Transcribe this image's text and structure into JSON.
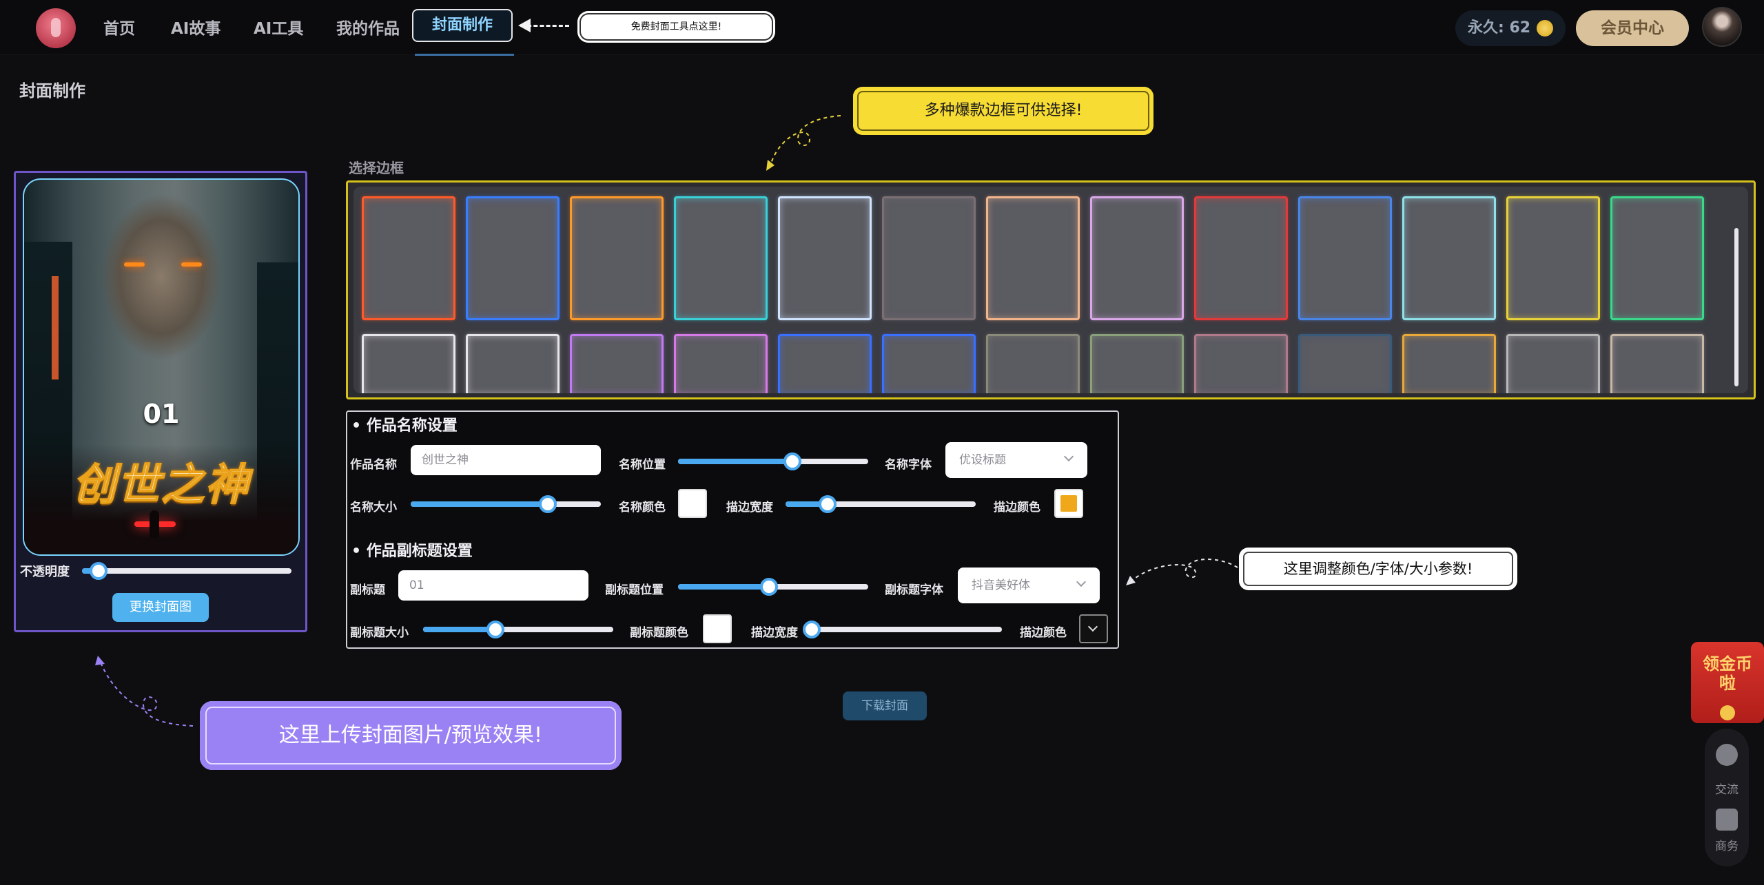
{
  "nav": {
    "items": [
      "首页",
      "AI故事",
      "AI工具",
      "我的作品"
    ],
    "active": "封面制作",
    "tip": "免费封面工具点这里!",
    "points": "永久: 62",
    "vip": "会员中心"
  },
  "page": {
    "title": "封面制作"
  },
  "tips": {
    "frames": "多种爆款边框可供选择!",
    "params": "这里调整颜色/字体/大小参数!",
    "upload": "这里上传封面图片/预览效果!"
  },
  "preview": {
    "subtitle": "01",
    "title": "创世之神",
    "opacity_label": "不透明度",
    "opacity_value": 0.08,
    "change_button": "更换封面图"
  },
  "frames": {
    "label": "选择边框",
    "row1_colors": [
      "#ff5a2a",
      "#3a7dff",
      "#ff9a2a",
      "#3ad0d8",
      "#cfe3ff",
      "#7a6f73",
      "#f2b48a",
      "#d9a8e8",
      "#e23a3a",
      "#4a86e8",
      "#8fe0e8",
      "#e8d23a",
      "#3ad88a"
    ],
    "row2_colors": [
      "#e6e6ea",
      "#e6e6ea",
      "#c07af2",
      "#d67ae8",
      "#3a6fff",
      "#3a6fff",
      "#8a8a7a",
      "#8aa07a",
      "#b07a8a",
      "#3a5a7a",
      "#e8a83a",
      "#b8b8b8",
      "#c8b8a8"
    ]
  },
  "name_settings": {
    "title": "• 作品名称设置",
    "name_label": "作品名称",
    "name_value": "创世之神",
    "position_label": "名称位置",
    "position_value": 0.6,
    "font_label": "名称字体",
    "font_value": "优设标题",
    "size_label": "名称大小",
    "size_value": 0.72,
    "color_label": "名称颜色",
    "color": "#ffffff",
    "stroke_width_label": "描边宽度",
    "stroke_width_value": 0.22,
    "stroke_color_label": "描边颜色",
    "stroke_color": "#f0a81a"
  },
  "subtitle_settings": {
    "title": "• 作品副标题设置",
    "sub_label": "副标题",
    "sub_value": "01",
    "position_label": "副标题位置",
    "position_value": 0.48,
    "font_label": "副标题字体",
    "font_value": "抖音美好体",
    "size_label": "副标题大小",
    "size_value": 0.38,
    "color_label": "副标题颜色",
    "color": "#ffffff",
    "stroke_width_label": "描边宽度",
    "stroke_width_value": 0.0,
    "stroke_color_label": "描边颜色"
  },
  "actions": {
    "download": "下载封面"
  },
  "side": {
    "redpacket": "领金币啦",
    "chat": "交流",
    "business": "商务"
  }
}
